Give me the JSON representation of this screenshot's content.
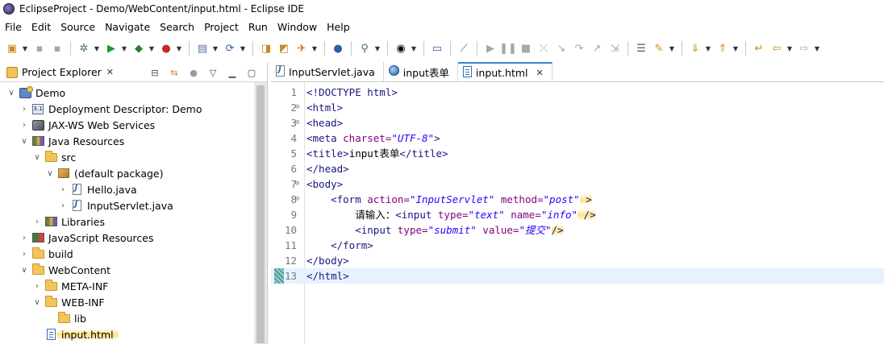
{
  "window": {
    "title": "EclipseProject - Demo/WebContent/input.html - Eclipse IDE"
  },
  "menu": [
    "File",
    "Edit",
    "Source",
    "Navigate",
    "Search",
    "Project",
    "Run",
    "Window",
    "Help"
  ],
  "explorer": {
    "title": "Project Explorer",
    "tree": [
      {
        "label": "Demo",
        "icon": "project-icon",
        "depth": 0,
        "expanded": true
      },
      {
        "label": "Deployment Descriptor: Demo",
        "icon": "deployment-descriptor-icon",
        "depth": 1,
        "expanded": false
      },
      {
        "label": "JAX-WS Web Services",
        "icon": "web-services-icon",
        "depth": 1,
        "expanded": false
      },
      {
        "label": "Java Resources",
        "icon": "java-resources-icon",
        "depth": 1,
        "expanded": true
      },
      {
        "label": "src",
        "icon": "source-folder-icon",
        "depth": 2,
        "expanded": true
      },
      {
        "label": "(default package)",
        "icon": "package-icon",
        "depth": 3,
        "expanded": true
      },
      {
        "label": "Hello.java",
        "icon": "java-file-icon",
        "depth": 4,
        "expanded": false
      },
      {
        "label": "InputServlet.java",
        "icon": "java-file-icon",
        "depth": 4,
        "expanded": false
      },
      {
        "label": "Libraries",
        "icon": "libraries-icon",
        "depth": 2,
        "expanded": false
      },
      {
        "label": "JavaScript Resources",
        "icon": "javascript-resources-icon",
        "depth": 1,
        "expanded": false
      },
      {
        "label": "build",
        "icon": "folder-icon",
        "depth": 1,
        "expanded": false
      },
      {
        "label": "WebContent",
        "icon": "folder-icon",
        "depth": 1,
        "expanded": true
      },
      {
        "label": "META-INF",
        "icon": "folder-icon",
        "depth": 2,
        "expanded": false
      },
      {
        "label": "WEB-INF",
        "icon": "folder-icon",
        "depth": 2,
        "expanded": true
      },
      {
        "label": "lib",
        "icon": "folder-icon",
        "depth": 3,
        "leaf": true
      },
      {
        "label": "input.html",
        "icon": "html-file-icon",
        "depth": 2,
        "leaf": true,
        "highlighted": true
      }
    ]
  },
  "editor": {
    "tabs": [
      {
        "label": "InputServlet.java",
        "icon": "java-file-icon",
        "active": false
      },
      {
        "label": "input表单",
        "icon": "browser-globe-icon",
        "active": false
      },
      {
        "label": "input.html",
        "icon": "html-file-icon",
        "active": true
      }
    ],
    "lines": [
      {
        "n": "1",
        "fold": "",
        "parts": [
          [
            "tag",
            "<!DOCTYPE html>"
          ]
        ]
      },
      {
        "n": "2",
        "fold": "⊖",
        "parts": [
          [
            "tag",
            "<html>"
          ]
        ]
      },
      {
        "n": "3",
        "fold": "⊖",
        "parts": [
          [
            "tag",
            "<head>"
          ]
        ]
      },
      {
        "n": "4",
        "fold": "",
        "parts": [
          [
            "tag",
            "<meta "
          ],
          [
            "attr",
            "charset="
          ],
          [
            "val",
            "\"UTF-8\""
          ],
          [
            "tag",
            ">"
          ]
        ]
      },
      {
        "n": "5",
        "fold": "",
        "parts": [
          [
            "tag",
            "<title>"
          ],
          [
            "plain",
            "input表单"
          ],
          [
            "tag",
            "</title>"
          ]
        ]
      },
      {
        "n": "6",
        "fold": "",
        "parts": [
          [
            "tag",
            "</head>"
          ]
        ]
      },
      {
        "n": "7",
        "fold": "⊖",
        "parts": [
          [
            "tag",
            "<body>"
          ]
        ]
      },
      {
        "n": "8",
        "fold": "⊖",
        "parts": [
          [
            "plain",
            "    "
          ],
          [
            "tag",
            "<form "
          ],
          [
            "attr",
            "action="
          ],
          [
            "val",
            "\"InputServlet\""
          ],
          [
            "plain",
            " "
          ],
          [
            "attr",
            "method="
          ],
          [
            "val",
            "\"post\""
          ],
          [
            "tag",
            " >"
          ]
        ],
        "highlight": true
      },
      {
        "n": "9",
        "fold": "",
        "parts": [
          [
            "plain",
            "        请输入："
          ],
          [
            "tag",
            "<input "
          ],
          [
            "attr",
            "type="
          ],
          [
            "val",
            "\"text\""
          ],
          [
            "plain",
            " "
          ],
          [
            "attr",
            "name="
          ],
          [
            "val",
            "\"info\""
          ],
          [
            "tag",
            " />"
          ]
        ],
        "highlight": true
      },
      {
        "n": "10",
        "fold": "",
        "parts": [
          [
            "plain",
            "        "
          ],
          [
            "tag",
            "<input "
          ],
          [
            "attr",
            "type="
          ],
          [
            "val",
            "\"submit\""
          ],
          [
            "plain",
            " "
          ],
          [
            "attr",
            "value="
          ],
          [
            "val",
            "\"提交\""
          ],
          [
            "tag",
            "/>"
          ]
        ],
        "highlight": true
      },
      {
        "n": "11",
        "fold": "",
        "parts": [
          [
            "plain",
            "    "
          ],
          [
            "tag",
            "</form>"
          ]
        ]
      },
      {
        "n": "12",
        "fold": "",
        "parts": [
          [
            "tag",
            "</body>"
          ]
        ]
      },
      {
        "n": "13",
        "fold": "",
        "parts": [
          [
            "tag",
            "</html>"
          ]
        ],
        "current": true
      }
    ]
  }
}
